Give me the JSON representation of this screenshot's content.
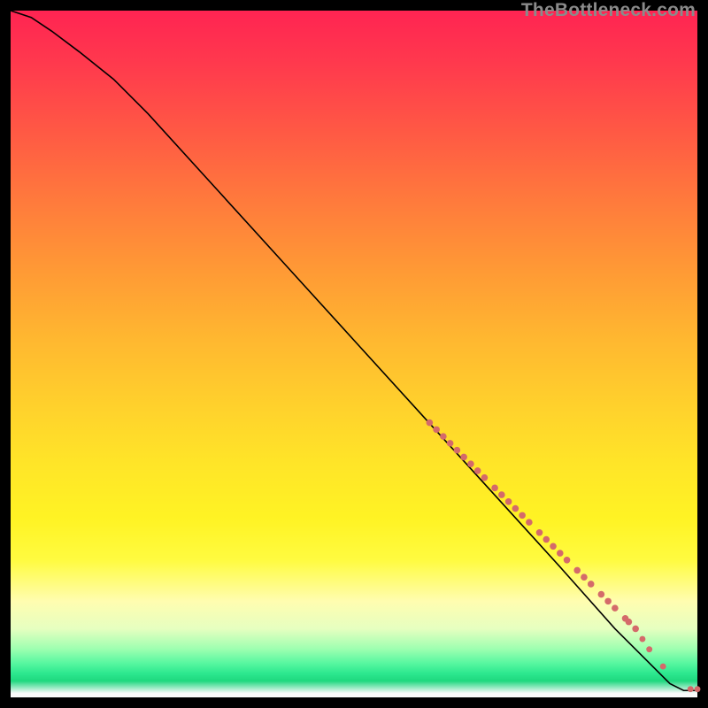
{
  "attribution": "TheBottleneck.com",
  "chart_data": {
    "type": "line",
    "title": "",
    "xlabel": "",
    "ylabel": "",
    "xlim": [
      0,
      100
    ],
    "ylim": [
      0,
      100
    ],
    "grid": false,
    "legend": false,
    "series": [
      {
        "name": "curve",
        "x": [
          0,
          3,
          6,
          10,
          15,
          20,
          30,
          40,
          50,
          60,
          70,
          80,
          88,
          93,
          96,
          98,
          100
        ],
        "y": [
          100,
          99,
          97,
          94,
          90,
          85,
          74,
          63,
          52,
          41,
          30,
          19,
          10,
          5,
          2,
          1,
          1
        ],
        "stroke": "#000000"
      }
    ],
    "markers": {
      "name": "highlight-points",
      "color": "#d46a6a",
      "points": [
        {
          "x": 61,
          "y": 40,
          "r": 3.3
        },
        {
          "x": 62,
          "y": 39,
          "r": 3.3
        },
        {
          "x": 63,
          "y": 38,
          "r": 3.3
        },
        {
          "x": 64,
          "y": 37,
          "r": 3.3
        },
        {
          "x": 65,
          "y": 36,
          "r": 3.3
        },
        {
          "x": 66,
          "y": 35,
          "r": 3.3
        },
        {
          "x": 67,
          "y": 34,
          "r": 3.3
        },
        {
          "x": 68,
          "y": 33,
          "r": 3.3
        },
        {
          "x": 69,
          "y": 32,
          "r": 3.3
        },
        {
          "x": 70.5,
          "y": 30.5,
          "r": 3.3
        },
        {
          "x": 71.5,
          "y": 29.5,
          "r": 3.3
        },
        {
          "x": 72.5,
          "y": 28.5,
          "r": 3.3
        },
        {
          "x": 73.5,
          "y": 27.5,
          "r": 3.3
        },
        {
          "x": 74.5,
          "y": 26.5,
          "r": 3.3
        },
        {
          "x": 75.5,
          "y": 25.5,
          "r": 3.3
        },
        {
          "x": 77,
          "y": 24,
          "r": 3.3
        },
        {
          "x": 78,
          "y": 23,
          "r": 3.3
        },
        {
          "x": 79,
          "y": 22,
          "r": 3.3
        },
        {
          "x": 80,
          "y": 21,
          "r": 3.3
        },
        {
          "x": 81,
          "y": 20,
          "r": 3.3
        },
        {
          "x": 82.5,
          "y": 18.5,
          "r": 3.3
        },
        {
          "x": 83.5,
          "y": 17.5,
          "r": 3.3
        },
        {
          "x": 84.5,
          "y": 16.5,
          "r": 3.3
        },
        {
          "x": 86,
          "y": 15,
          "r": 3.3
        },
        {
          "x": 87,
          "y": 14,
          "r": 3.3
        },
        {
          "x": 88,
          "y": 13,
          "r": 3.3
        },
        {
          "x": 89.5,
          "y": 11.5,
          "r": 3.3
        },
        {
          "x": 90,
          "y": 11,
          "r": 3.3
        },
        {
          "x": 91,
          "y": 10,
          "r": 3.3
        },
        {
          "x": 92,
          "y": 8.5,
          "r": 3.0
        },
        {
          "x": 93,
          "y": 7,
          "r": 3.0
        },
        {
          "x": 95,
          "y": 4.5,
          "r": 3.0
        },
        {
          "x": 99,
          "y": 1.2,
          "r": 3.0
        },
        {
          "x": 100,
          "y": 1.2,
          "r": 3.0
        }
      ]
    }
  }
}
